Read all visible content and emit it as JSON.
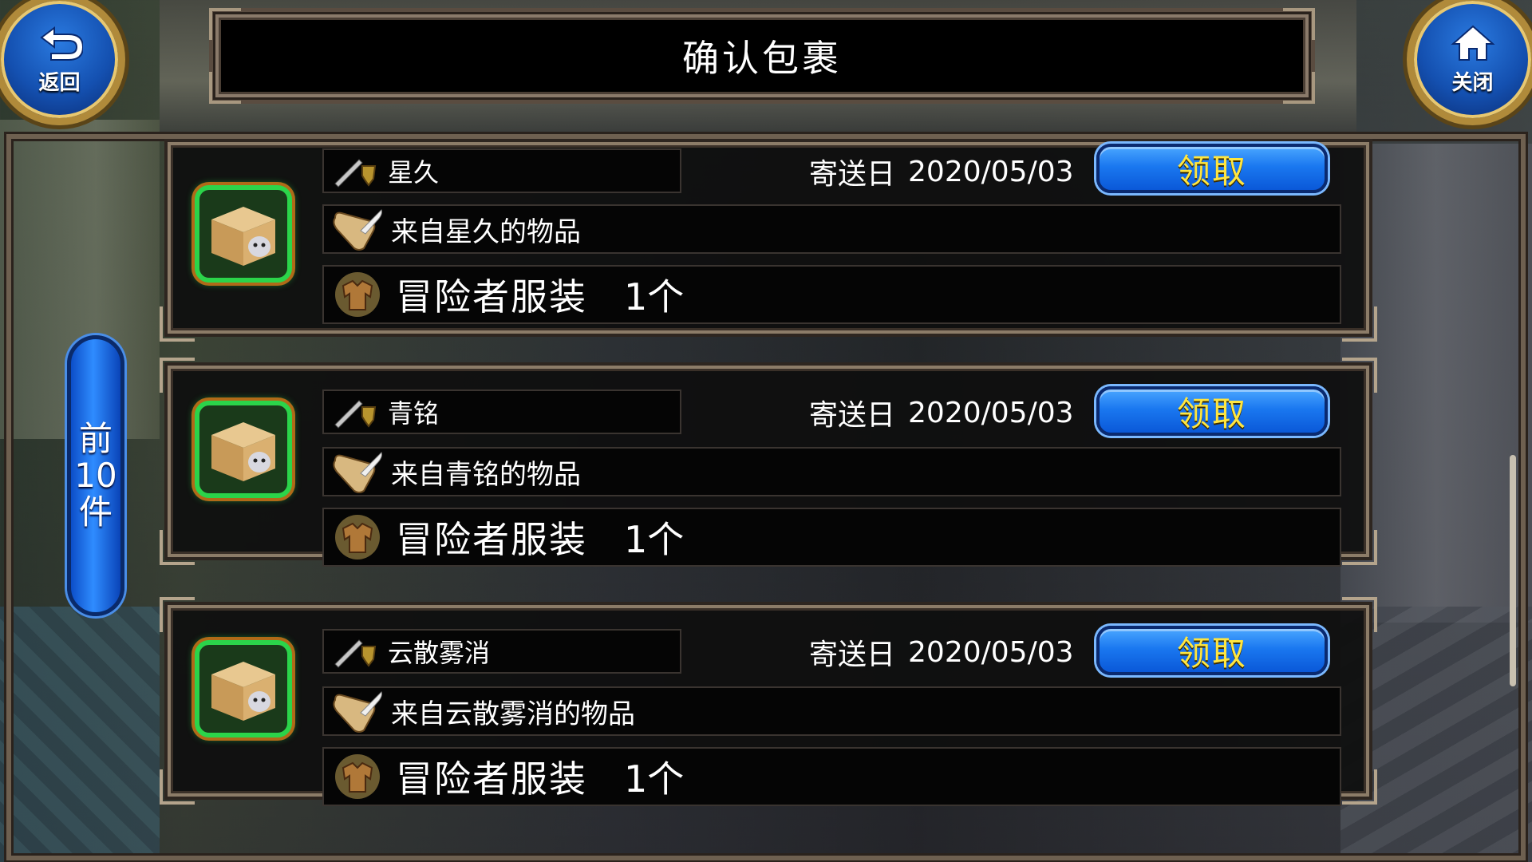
{
  "header": {
    "title": "确认包裹",
    "back_label": "返回",
    "close_label": "关闭"
  },
  "side_tab": {
    "label_lines": [
      "前",
      "10",
      "件"
    ]
  },
  "mails": [
    {
      "sender": "星久",
      "date_label": "寄送日",
      "date": "2020/05/03",
      "claim_label": "领取",
      "note": "来自星久的物品",
      "item_name": "冒险者服装",
      "item_qty": "1个"
    },
    {
      "sender": "青铭",
      "date_label": "寄送日",
      "date": "2020/05/03",
      "claim_label": "领取",
      "note": "来自青铭的物品",
      "item_name": "冒险者服装",
      "item_qty": "1个"
    },
    {
      "sender": "云散雾消",
      "date_label": "寄送日",
      "date": "2020/05/03",
      "claim_label": "领取",
      "note": "来自云散雾消的物品",
      "item_name": "冒险者服装",
      "item_qty": "1个"
    }
  ],
  "colors": {
    "claim_button": "#1a78f0",
    "claim_text": "#ffe640",
    "box_border": "#2bd44a",
    "side_tab": "#2f8cff"
  }
}
